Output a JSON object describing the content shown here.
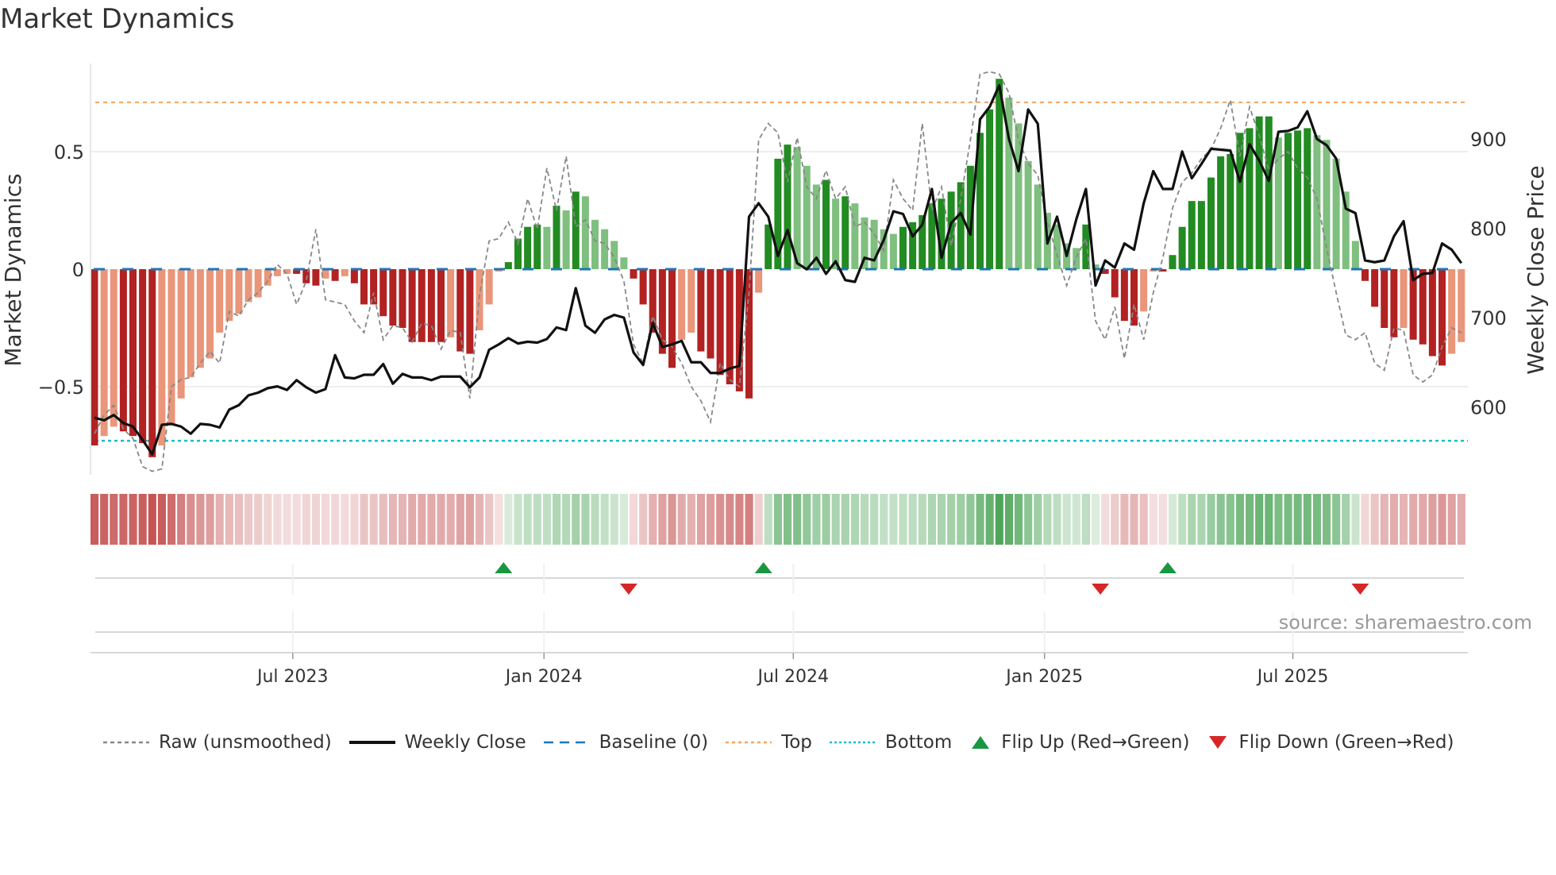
{
  "title": "Market Dynamics",
  "source": "source: sharemaestro.com",
  "legend": [
    {
      "key": "raw",
      "label": "Raw (unsmoothed)"
    },
    {
      "key": "close",
      "label": "Weekly Close"
    },
    {
      "key": "baseline",
      "label": "Baseline (0)"
    },
    {
      "key": "top",
      "label": "Top"
    },
    {
      "key": "bottom",
      "label": "Bottom"
    },
    {
      "key": "flip_up",
      "label": "Flip Up (Red→Green)"
    },
    {
      "key": "flip_down",
      "label": "Flip Down (Green→Red)"
    }
  ],
  "colors": {
    "pos_strong": "#228b22",
    "pos_weak": "#7fbf7f",
    "neg_strong": "#b22222",
    "neg_weak": "#e9967a",
    "raw": "#888888",
    "close": "#111111",
    "baseline": "#1f77b4",
    "top": "#f4a460",
    "bottom": "#17becf",
    "flip_up": "#1a9641",
    "flip_down": "#d62728"
  },
  "chart_data": {
    "type": "bar",
    "title": "Market Dynamics",
    "ylabel": "Market Dynamics",
    "y2label": "Weekly Close Price",
    "ylim": [
      -0.82,
      0.88
    ],
    "y2lim": [
      536,
      986
    ],
    "yticks": [
      {
        "value": 0.5,
        "label": "0.5"
      },
      {
        "value": 0,
        "label": "0"
      },
      {
        "value": -0.5,
        "label": "−0.5"
      }
    ],
    "y2ticks": [
      {
        "value": 900,
        "label": "900"
      },
      {
        "value": 800,
        "label": "800"
      },
      {
        "value": 700,
        "label": "700"
      },
      {
        "value": 600,
        "label": "600"
      }
    ],
    "xticks": [
      {
        "week": 20.6,
        "label": "Jul 2023"
      },
      {
        "week": 46.7,
        "label": "Jan 2024"
      },
      {
        "week": 72.6,
        "label": "Jul 2024"
      },
      {
        "week": 98.7,
        "label": "Jan 2025"
      },
      {
        "week": 124.5,
        "label": "Jul 2025"
      }
    ],
    "baseline": 0,
    "top": 0.71,
    "bottom": -0.73,
    "values": [
      -0.75,
      -0.71,
      -0.67,
      -0.69,
      -0.71,
      -0.74,
      -0.8,
      -0.75,
      -0.66,
      -0.55,
      -0.46,
      -0.42,
      -0.38,
      -0.27,
      -0.22,
      -0.19,
      -0.14,
      -0.12,
      -0.07,
      -0.03,
      -0.02,
      -0.02,
      -0.06,
      -0.07,
      -0.04,
      -0.05,
      -0.03,
      -0.06,
      -0.15,
      -0.15,
      -0.2,
      -0.24,
      -0.25,
      -0.31,
      -0.31,
      -0.31,
      -0.31,
      -0.29,
      -0.35,
      -0.36,
      -0.26,
      -0.15,
      -0.01,
      0.03,
      0.13,
      0.18,
      0.19,
      0.18,
      0.27,
      0.25,
      0.33,
      0.31,
      0.21,
      0.17,
      0.12,
      0.05,
      -0.04,
      -0.15,
      -0.27,
      -0.36,
      -0.42,
      -0.3,
      -0.27,
      -0.35,
      -0.38,
      -0.45,
      -0.49,
      -0.52,
      -0.55,
      -0.1,
      0.19,
      0.47,
      0.53,
      0.52,
      0.44,
      0.36,
      0.38,
      0.3,
      0.31,
      0.28,
      0.22,
      0.21,
      0.17,
      0.15,
      0.18,
      0.2,
      0.23,
      0.28,
      0.3,
      0.33,
      0.37,
      0.44,
      0.58,
      0.68,
      0.81,
      0.73,
      0.62,
      0.46,
      0.36,
      0.24,
      0.19,
      0.11,
      0.09,
      0.19,
      0.02,
      -0.02,
      -0.12,
      -0.22,
      -0.24,
      -0.18,
      -0.01,
      -0.01,
      0.06,
      0.18,
      0.29,
      0.29,
      0.39,
      0.48,
      0.49,
      0.58,
      0.6,
      0.65,
      0.65,
      0.56,
      0.58,
      0.59,
      0.6,
      0.57,
      0.55,
      0.47,
      0.33,
      0.12,
      -0.05,
      -0.16,
      -0.25,
      -0.29,
      -0.25,
      -0.3,
      -0.32,
      -0.37,
      -0.41,
      -0.36,
      -0.31
    ],
    "raw": [
      -0.7,
      -0.62,
      -0.58,
      -0.68,
      -0.72,
      -0.84,
      -0.86,
      -0.85,
      -0.5,
      -0.47,
      -0.46,
      -0.4,
      -0.35,
      -0.4,
      -0.18,
      -0.2,
      -0.13,
      -0.1,
      -0.05,
      0.02,
      -0.02,
      -0.15,
      -0.05,
      0.17,
      -0.13,
      -0.14,
      -0.15,
      -0.22,
      -0.27,
      -0.1,
      -0.3,
      -0.24,
      -0.25,
      -0.31,
      -0.23,
      -0.24,
      -0.34,
      -0.26,
      -0.27,
      -0.55,
      -0.11,
      0.12,
      0.13,
      0.2,
      0.11,
      0.3,
      0.17,
      0.43,
      0.25,
      0.48,
      0.18,
      0.21,
      0.12,
      0.11,
      0.05,
      -0.05,
      -0.32,
      -0.4,
      -0.2,
      -0.3,
      -0.33,
      -0.4,
      -0.5,
      -0.56,
      -0.65,
      -0.4,
      -0.47,
      -0.5,
      -0.1,
      0.55,
      0.62,
      0.58,
      0.37,
      0.56,
      0.35,
      0.3,
      0.42,
      0.3,
      0.35,
      0.18,
      0.2,
      0.15,
      0.08,
      0.38,
      0.3,
      0.25,
      0.62,
      0.25,
      0.35,
      0.1,
      0.3,
      0.55,
      0.83,
      0.84,
      0.83,
      0.75,
      0.55,
      0.45,
      0.4,
      0.2,
      0.06,
      -0.07,
      0.05,
      0.13,
      -0.22,
      -0.3,
      -0.16,
      -0.38,
      -0.15,
      -0.3,
      -0.1,
      0.05,
      0.26,
      0.37,
      0.41,
      0.47,
      0.51,
      0.6,
      0.72,
      0.48,
      0.69,
      0.57,
      0.42,
      0.47,
      0.5,
      0.43,
      0.39,
      0.3,
      0.09,
      -0.1,
      -0.28,
      -0.3,
      -0.27,
      -0.4,
      -0.43,
      -0.25,
      -0.26,
      -0.45,
      -0.48,
      -0.45,
      -0.33,
      -0.25,
      -0.27
    ],
    "close": [
      588,
      585,
      591,
      582,
      578,
      563,
      547,
      580,
      581,
      578,
      570,
      581,
      580,
      577,
      597,
      602,
      613,
      616,
      621,
      623,
      619,
      630,
      622,
      616,
      620,
      658,
      633,
      632,
      636,
      636,
      648,
      626,
      637,
      633,
      633,
      630,
      634,
      634,
      634,
      622,
      633,
      664,
      670,
      677,
      671,
      673,
      672,
      676,
      689,
      686,
      733,
      691,
      683,
      698,
      703,
      700,
      661,
      647,
      694,
      667,
      670,
      674,
      650,
      650,
      638,
      638,
      643,
      646,
      813,
      828,
      813,
      769,
      798,
      761,
      754,
      767,
      749,
      763,
      742,
      740,
      767,
      764,
      787,
      819,
      816,
      791,
      804,
      844,
      767,
      806,
      817,
      793,
      922,
      936,
      960,
      900,
      864,
      933,
      917,
      783,
      813,
      769,
      810,
      844,
      736,
      764,
      756,
      783,
      776,
      828,
      864,
      844,
      844,
      886,
      856,
      872,
      889,
      888,
      887,
      852,
      894,
      876,
      853,
      908,
      909,
      913,
      931,
      900,
      893,
      878,
      822,
      817,
      764,
      762,
      764,
      791,
      808,
      742,
      749,
      750,
      783,
      776,
      761
    ],
    "flips": [
      {
        "type": "up",
        "week": 43
      },
      {
        "type": "down",
        "week": 56
      },
      {
        "type": "up",
        "week": 70
      },
      {
        "type": "down",
        "week": 105
      },
      {
        "type": "up",
        "week": 112
      },
      {
        "type": "down",
        "week": 132
      }
    ]
  }
}
